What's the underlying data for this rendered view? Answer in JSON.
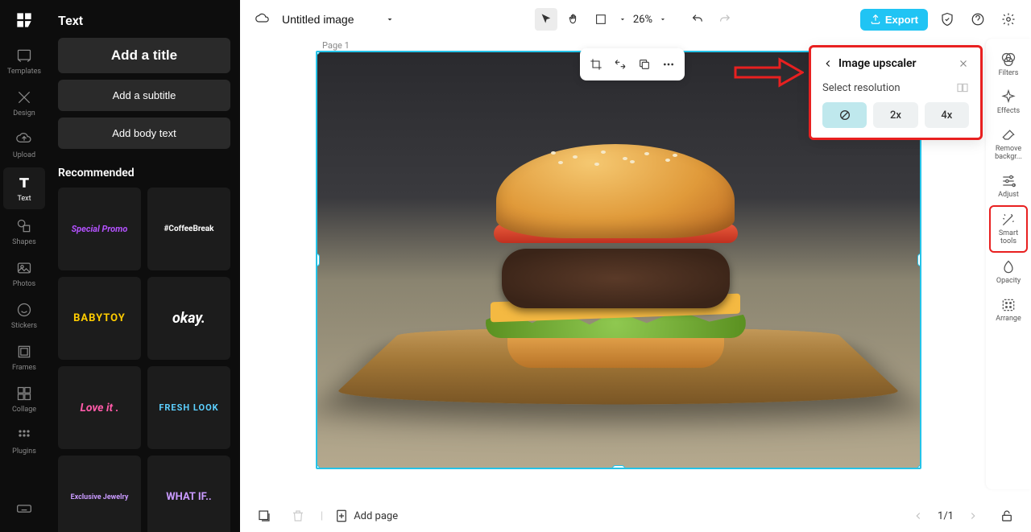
{
  "left_rail": {
    "items": [
      {
        "label": "Templates"
      },
      {
        "label": "Design"
      },
      {
        "label": "Upload"
      },
      {
        "label": "Text"
      },
      {
        "label": "Shapes"
      },
      {
        "label": "Photos"
      },
      {
        "label": "Stickers"
      },
      {
        "label": "Frames"
      },
      {
        "label": "Collage"
      },
      {
        "label": "Plugins"
      }
    ]
  },
  "text_panel": {
    "title": "Text",
    "add_title": "Add a title",
    "add_subtitle": "Add a subtitle",
    "add_body": "Add body text",
    "recommended": "Recommended",
    "thumbs": [
      {
        "text": "Special Promo",
        "color": "#b452ff"
      },
      {
        "text": "#CoffeeBreak",
        "color": "#ffffff"
      },
      {
        "text": "BABYTOY",
        "color": "#ffcc00"
      },
      {
        "text": "okay.",
        "color": "#ffffff"
      },
      {
        "text": "Love it .",
        "color": "#ff5aa8"
      },
      {
        "text": "FRESH LOOK",
        "color": "#5cd0ff"
      },
      {
        "text": "Exclusive Jewelry",
        "color": "#c99aff"
      },
      {
        "text": "WHAT IF..",
        "color": "#c99aff"
      }
    ]
  },
  "topbar": {
    "doc_title": "Untitled image",
    "zoom": "26%",
    "export": "Export"
  },
  "canvas": {
    "page_label": "Page 1"
  },
  "right_rail": {
    "items": [
      {
        "label": "Filters"
      },
      {
        "label": "Effects"
      },
      {
        "label": "Remove backgr..."
      },
      {
        "label": "Adjust"
      },
      {
        "label": "Smart tools"
      },
      {
        "label": "Opacity"
      },
      {
        "label": "Arrange"
      }
    ]
  },
  "upscaler": {
    "title": "Image upscaler",
    "select_label": "Select resolution",
    "opt_2x": "2x",
    "opt_4x": "4x"
  },
  "bottom": {
    "add_page": "Add page",
    "page_indicator": "1/1"
  }
}
